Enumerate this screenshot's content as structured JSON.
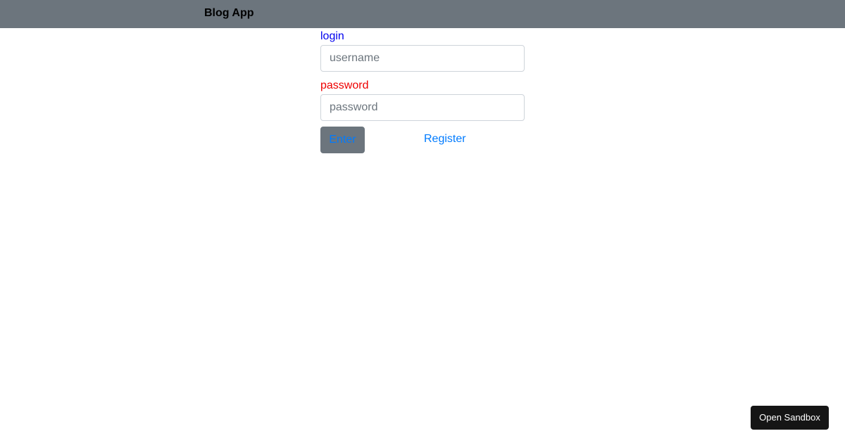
{
  "navbar": {
    "brand": "Blog App"
  },
  "login_form": {
    "login_label": "login",
    "username_placeholder": "username",
    "username_value": "",
    "password_label": "password",
    "password_placeholder": "password",
    "password_value": "",
    "enter_button": "Enter",
    "register_link": "Register"
  },
  "sandbox": {
    "button_label": "Open Sandbox"
  },
  "colors": {
    "navbar_bg": "#6c757d",
    "login_label": "#0000ee",
    "password_label": "#ee0000",
    "link": "#007bff",
    "sandbox_bg": "#151515"
  }
}
